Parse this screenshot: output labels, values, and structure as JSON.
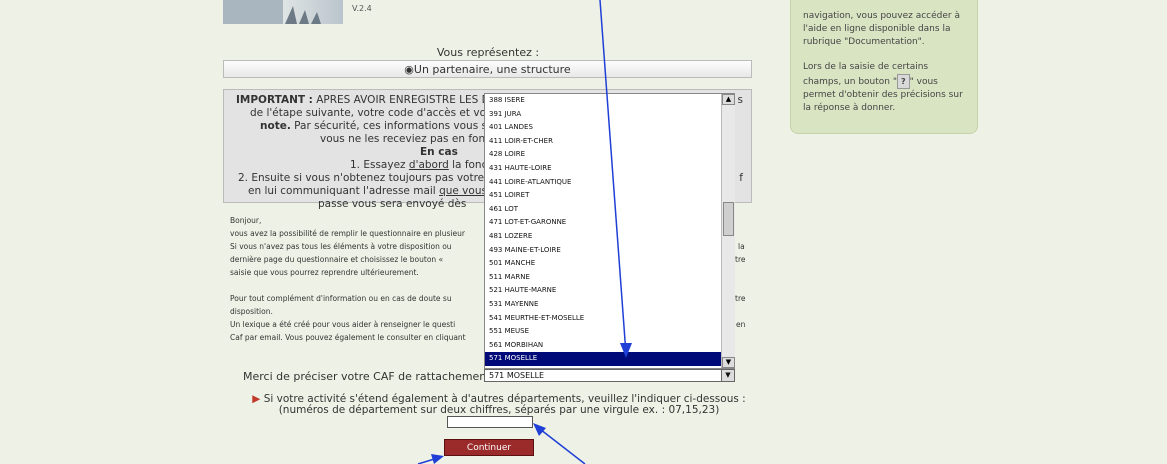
{
  "logo": {
    "version_text": "V.2.4"
  },
  "right_panel": {
    "paragraph1": "navigation, vous pouvez accéder à l'aide en ligne disponible dans la rubrique \"Documentation\".",
    "paragraph2_before": "Lors de la saisie de certains champs, un bouton \"",
    "help_button": "?",
    "paragraph2_after": "\" vous permet d'obtenir des précisions sur la réponse à donner."
  },
  "representation": {
    "label": "Vous représentez :",
    "option": "Un partenaire, une structure"
  },
  "important": {
    "line1_bold": "IMPORTANT :",
    "line1": "APRES AVOIR ENREGISTRE LES DO",
    "line1_tail": "s",
    "line2": "de l'étape suivante, votre code d'accès et votr",
    "line3_bold": "note.",
    "line3": "Par sécurité, ces informations vous sero",
    "line4": "vous ne les receviez pas en fon",
    "line5_bold": "En cas",
    "line6": "1. Essayez",
    "line6_underline": "d'abord",
    "line6_tail": "la fonc",
    "line7": "2. Ensuite si vous n'obtenez toujours pas votre",
    "line7_tail": "f",
    "line8": "en lui communiquant l'adresse mail",
    "line8_underline": "que vous",
    "line9": "passe vous sera envoyé dès"
  },
  "body": {
    "greeting": "Bonjour,",
    "line1": "vous avez la possibilité de remplir le questionnaire en plusieur",
    "line2": "Si vous n'avez pas tous les éléments à votre disposition ou",
    "line2_tail": "la",
    "line3": "dernière page du questionnaire et choisissez le bouton «",
    "line3_tail": "tre",
    "line4": "saisie que vous pourrez reprendre ultérieurement.",
    "line5": "Pour tout complément d'information ou en cas de doute su",
    "line5_tail": "tre",
    "line6": "disposition.",
    "line7": "Un lexique a été créé pour vous aider à renseigner le questi",
    "line7_tail": "en",
    "line8": "Caf par email. Vous pouvez également le consulter en cliquant"
  },
  "caf_list": {
    "options": [
      "388 ISERE",
      "391 JURA",
      "401 LANDES",
      "411 LOIR-ET-CHER",
      "428 LOIRE",
      "431 HAUTE-LOIRE",
      "441 LOIRE-ATLANTIQUE",
      "451 LOIRET",
      "461 LOT",
      "471 LOT-ET-GARONNE",
      "481 LOZERE",
      "493 MAINE-ET-LOIRE",
      "501 MANCHE",
      "511 MARNE",
      "521 HAUTE-MARNE",
      "531 MAYENNE",
      "541 MEURTHE-ET-MOSELLE",
      "551 MEUSE",
      "561 MORBIHAN",
      "571 MOSELLE"
    ],
    "selected_index": 19
  },
  "caf": {
    "label": "Merci de préciser votre CAF de rattachement :",
    "selected_value": "571 MOSELLE"
  },
  "activity": {
    "line1": "Si votre activité s'étend également à d'autres départements, veuillez l'indiquer ci-dessous :",
    "line2": "(numéros de département sur deux chiffres, séparés par une virgule ex. : 07,15,23)"
  },
  "continue_label": "Continuer",
  "colors": {
    "selected_bg": "#000a78",
    "button_bg": "#9b2a2a",
    "annotation_arrow": "#1f3fd6",
    "side_panel": "#d9e4c3"
  }
}
